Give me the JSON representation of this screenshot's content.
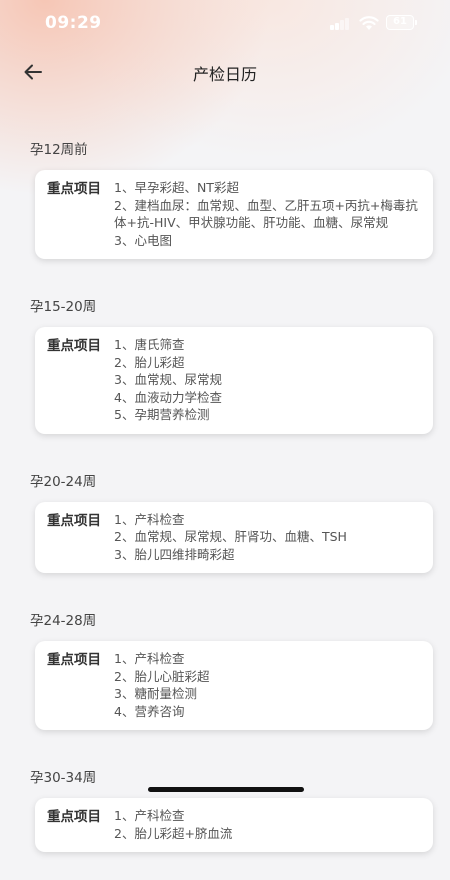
{
  "status": {
    "time": "09:29",
    "battery": "61"
  },
  "header": {
    "title": "产检日历"
  },
  "card_label": "重点项目",
  "sections": [
    {
      "week": "孕12周前",
      "items": [
        "1、早孕彩超、NT彩超",
        "2、建档血尿：血常规、血型、乙肝五项+丙抗+梅毒抗体+抗-HIV、甲状腺功能、肝功能、血糖、尿常规",
        "3、心电图"
      ]
    },
    {
      "week": "孕15-20周",
      "items": [
        "1、唐氏筛查",
        "2、胎儿彩超",
        "3、血常规、尿常规",
        "4、血液动力学检查",
        "5、孕期营养检测"
      ]
    },
    {
      "week": "孕20-24周",
      "items": [
        "1、产科检查",
        "2、血常规、尿常规、肝肾功、血糖、TSH",
        "3、胎儿四维排畸彩超"
      ]
    },
    {
      "week": "孕24-28周",
      "items": [
        "1、产科检查",
        "2、胎儿心脏彩超",
        "3、糖耐量检测",
        "4、营养咨询"
      ]
    },
    {
      "week": "孕30-34周",
      "items": [
        "1、产科检查",
        "2、胎儿彩超+脐血流"
      ]
    }
  ]
}
